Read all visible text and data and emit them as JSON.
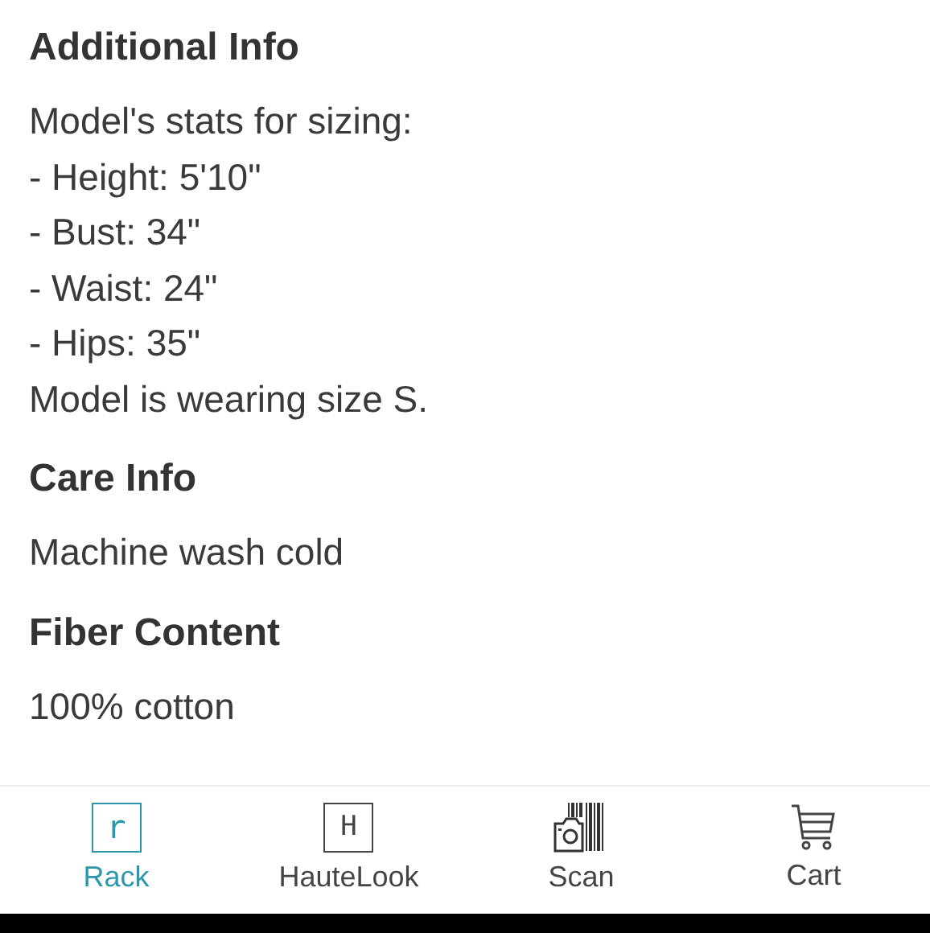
{
  "sections": [
    {
      "title": "Additional Info",
      "lines": [
        "Model's stats for sizing:",
        "- Height: 5'10\"",
        "- Bust: 34\"",
        "- Waist: 24\"",
        "- Hips: 35\"",
        "Model is wearing size S."
      ]
    },
    {
      "title": "Care Info",
      "lines": [
        "Machine wash cold"
      ]
    },
    {
      "title": "Fiber Content",
      "lines": [
        "100% cotton"
      ]
    }
  ],
  "bottom_nav": [
    {
      "label": "Rack",
      "kind": "letter",
      "icon_letter": "r",
      "selected": true
    },
    {
      "label": "HauteLook",
      "kind": "letter",
      "icon_letter": "H",
      "selected": false
    },
    {
      "label": "Scan",
      "kind": "scan",
      "selected": false
    },
    {
      "label": "Cart",
      "kind": "cart",
      "selected": false
    }
  ]
}
